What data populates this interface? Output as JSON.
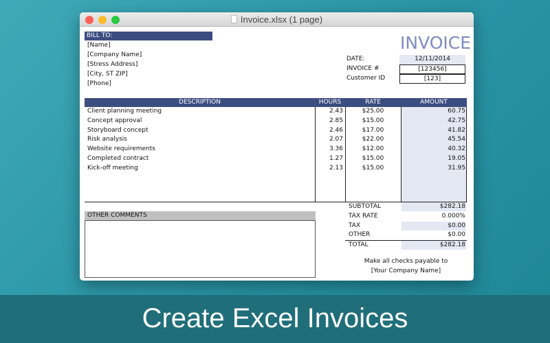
{
  "window": {
    "title": "Invoice.xlsx (1 page)"
  },
  "invoice": {
    "heading": "INVOICE",
    "bill_to": {
      "label": "BILL TO:",
      "lines": [
        "[Name]",
        "[Company Name]",
        "[Stress Address]",
        "[City, ST  ZIP]",
        "[Phone]"
      ]
    },
    "meta": [
      {
        "label": "DATE:",
        "value": "12/11/2014"
      },
      {
        "label": "INVOICE #",
        "value": "[123456]"
      },
      {
        "label": "Customer ID",
        "value": "[123]"
      }
    ],
    "columns": [
      "DESCRIPTION",
      "HOURS",
      "RATE",
      "AMOUNT"
    ],
    "rows": [
      {
        "description": "Client planning meeting",
        "hours": "2.43",
        "rate": "$25.00",
        "amount": "60.75"
      },
      {
        "description": "Concept approval",
        "hours": "2.85",
        "rate": "$15.00",
        "amount": "42.75"
      },
      {
        "description": "Storyboard concept",
        "hours": "2.46",
        "rate": "$17.00",
        "amount": "41.82"
      },
      {
        "description": "Risk analysis",
        "hours": "2.07",
        "rate": "$22.00",
        "amount": "45.54"
      },
      {
        "description": "Website requirements",
        "hours": "3.36",
        "rate": "$12.00",
        "amount": "40.32"
      },
      {
        "description": "Completed contract",
        "hours": "1.27",
        "rate": "$15.00",
        "amount": "19.05"
      },
      {
        "description": "Kick-off meeting",
        "hours": "2.13",
        "rate": "$15.00",
        "amount": "31.95"
      }
    ],
    "comments_label": "OTHER COMMENTS",
    "totals": [
      {
        "label": "SUBTOTAL",
        "value": "$282.18"
      },
      {
        "label": "TAX RATE",
        "value": "0.000%"
      },
      {
        "label": "TAX",
        "value": "$0.00"
      },
      {
        "label": "OTHER",
        "value": "$0.00"
      },
      {
        "label": "TOTAL",
        "value": "$282.18"
      }
    ],
    "payable_line1": "Make all checks payable to",
    "payable_line2": "[Your Company Name]"
  },
  "banner": "Create Excel Invoices",
  "colors": {
    "header": "#3c4d80",
    "shade": "#e4e8f3",
    "heading": "#7f8cc0"
  }
}
